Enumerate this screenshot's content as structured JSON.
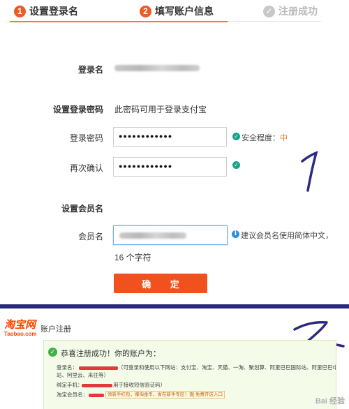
{
  "steps": [
    {
      "num": "1",
      "label": "设置登录名"
    },
    {
      "num": "2",
      "label": "填写账户信息"
    },
    {
      "num": "✓",
      "label": "注册成功"
    }
  ],
  "form": {
    "login_name_label": "登录名",
    "set_password_heading": "设置登录密码",
    "set_password_note": "此密码可用于登录支付宝",
    "password_label": "登录密码",
    "password_value": "●●●●●●●●●●●●",
    "strength_label": "安全程度：",
    "strength_level": "中",
    "confirm_label": "再次确认",
    "confirm_value": "●●●●●●●●●●●●",
    "member_heading": "设置会员名",
    "member_label": "会员名",
    "member_hint": "建议会员名使用简体中文，",
    "char_count": "16 个字符",
    "confirm_button": "确 定"
  },
  "success": {
    "logo_cn": "淘宝网",
    "logo_en": "Taobao.com",
    "page_title": "账户注册",
    "headline": "恭喜注册成功！你的账户为：",
    "login_name_label": "登录名：",
    "login_name_desc": "（可登录和使用以下网站：支付宝、淘宝、天猫、一淘、聚划算、阿里巴巴国际站、阿里巴巴中文",
    "login_name_desc2": "站、阿里云、来往等）",
    "phone_label": "绑定手机：",
    "phone_desc": "用于接收短信验证码）",
    "member_label": "淘宝会员名：",
    "btn1": "领新手红包，赚淘金币，省在新手专区！查看详情",
    "btn2": "免费开店入口"
  },
  "watermark": "Bai 经验",
  "colors": {
    "accent": "#ef5a24",
    "success": "#17a589",
    "info": "#2d8ee0",
    "taobao": "#ff4400"
  }
}
